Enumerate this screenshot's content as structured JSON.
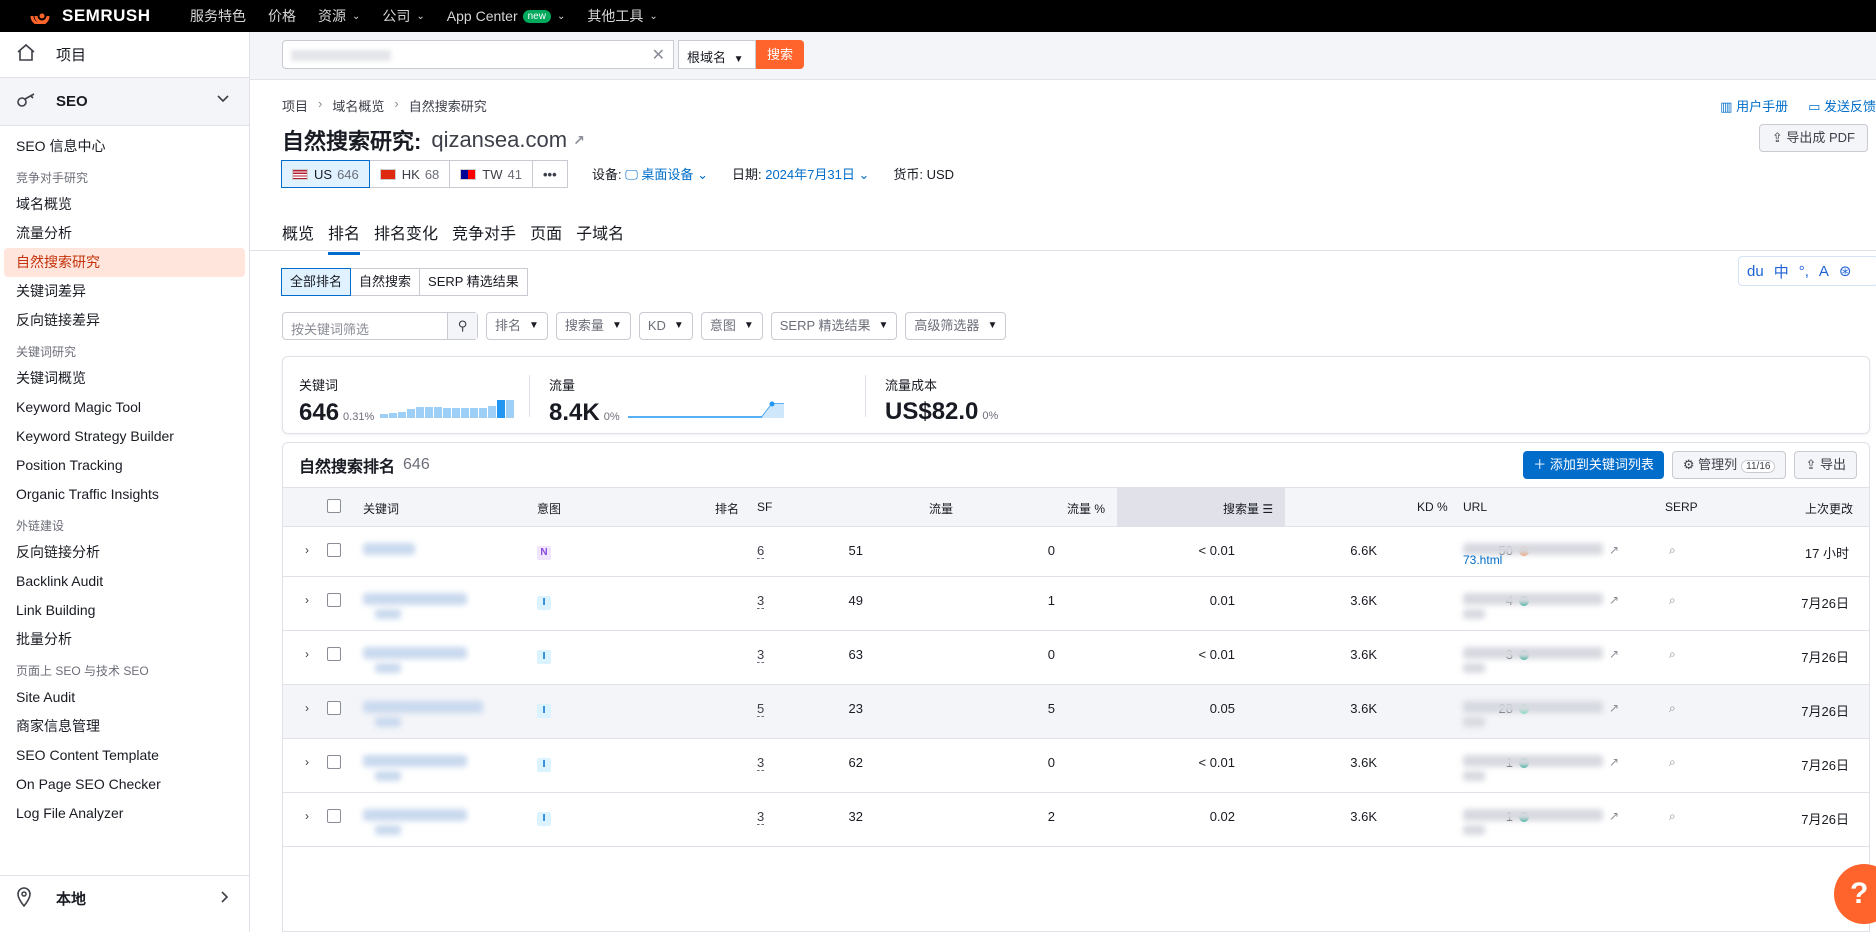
{
  "topbar": {
    "brand": "SEMRUSH",
    "nav": [
      {
        "label": "服务特色",
        "chev": false
      },
      {
        "label": "价格",
        "chev": false
      },
      {
        "label": "资源",
        "chev": true
      },
      {
        "label": "公司",
        "chev": true
      },
      {
        "label": "App Center",
        "chev": true,
        "badge": "new"
      },
      {
        "label": "其他工具",
        "chev": true
      }
    ]
  },
  "sidebar": {
    "project": "项目",
    "seo": "SEO",
    "items": [
      {
        "t": "item",
        "label": "SEO 信息中心"
      },
      {
        "t": "head",
        "label": "竞争对手研究"
      },
      {
        "t": "item",
        "label": "域名概览"
      },
      {
        "t": "item",
        "label": "流量分析"
      },
      {
        "t": "item",
        "label": "自然搜索研究",
        "active": true
      },
      {
        "t": "item",
        "label": "关键词差异"
      },
      {
        "t": "item",
        "label": "反向链接差异"
      },
      {
        "t": "head",
        "label": "关键词研究"
      },
      {
        "t": "item",
        "label": "关键词概览"
      },
      {
        "t": "item",
        "label": "Keyword Magic Tool"
      },
      {
        "t": "item",
        "label": "Keyword Strategy Builder"
      },
      {
        "t": "item",
        "label": "Position Tracking"
      },
      {
        "t": "item",
        "label": "Organic Traffic Insights"
      },
      {
        "t": "head",
        "label": "外链建设"
      },
      {
        "t": "item",
        "label": "反向链接分析"
      },
      {
        "t": "item",
        "label": "Backlink Audit"
      },
      {
        "t": "item",
        "label": "Link Building"
      },
      {
        "t": "item",
        "label": "批量分析"
      },
      {
        "t": "head",
        "label": "页面上 SEO 与技术 SEO"
      },
      {
        "t": "item",
        "label": "Site Audit"
      },
      {
        "t": "item",
        "label": "商家信息管理"
      },
      {
        "t": "item",
        "label": "SEO Content Template"
      },
      {
        "t": "item",
        "label": "On Page SEO Checker"
      },
      {
        "t": "item",
        "label": "Log File Analyzer"
      }
    ],
    "local": "本地"
  },
  "search": {
    "select": "根域名",
    "button": "搜索"
  },
  "breadcrumb": [
    "项目",
    "域名概览",
    "自然搜索研究"
  ],
  "toplinks": {
    "manual": "用户手册",
    "feedback": "发送反馈"
  },
  "title": {
    "label": "自然搜索研究:",
    "domain": "qizansea.com"
  },
  "export_pdf": "导出成 PDF",
  "countries": [
    {
      "code": "US",
      "num": "646",
      "selected": true
    },
    {
      "code": "HK",
      "num": "68"
    },
    {
      "code": "TW",
      "num": "41"
    }
  ],
  "meta": {
    "device_label": "设备:",
    "device": "桌面设备",
    "date_label": "日期:",
    "date": "2024年7月31日",
    "currency_label": "货币:",
    "currency": "USD"
  },
  "tabs": [
    "概览",
    "排名",
    "排名变化",
    "竞争对手",
    "页面",
    "子域名"
  ],
  "segments": [
    "全部排名",
    "自然搜索",
    "SERP 精选结果"
  ],
  "filters": {
    "placeholder": "按关键词筛选",
    "dropdowns": [
      "排名",
      "搜索量",
      "KD",
      "意图",
      "SERP 精选结果",
      "高级筛选器"
    ]
  },
  "stats": {
    "keywords": {
      "label": "关键词",
      "value": "646",
      "pct": "0.31%"
    },
    "traffic": {
      "label": "流量",
      "value": "8.4K",
      "pct": "0%"
    },
    "cost": {
      "label": "流量成本",
      "value": "US$82.0",
      "pct": "0%"
    }
  },
  "table": {
    "title": "自然搜索排名",
    "count": "646",
    "add_button": "添加到关键词列表",
    "manage": "管理列",
    "manage_count": "11/16",
    "export": "导出",
    "headers": {
      "keyword": "关键词",
      "intent": "意图",
      "pos": "排名",
      "sf": "SF",
      "traffic": "流量",
      "traffic_pct": "流量 %",
      "volume": "搜索量",
      "kd": "KD %",
      "url": "URL",
      "serp": "SERP",
      "updated": "上次更改"
    },
    "rows": [
      {
        "intent": "N",
        "pos": "51",
        "sf": "6",
        "traffic": "0",
        "tpct": "< 0.01",
        "vol": "6.6K",
        "kd": "50",
        "kdc": "#ff8c43",
        "url_tail": "73.html",
        "updated": "17 小时"
      },
      {
        "intent": "I",
        "pos": "49",
        "sf": "3",
        "traffic": "1",
        "tpct": "0.01",
        "vol": "3.6K",
        "kd": "4",
        "kdc": "#009f81",
        "url_tail": "",
        "updated": "7月26日"
      },
      {
        "intent": "I",
        "pos": "63",
        "sf": "3",
        "traffic": "0",
        "tpct": "< 0.01",
        "vol": "3.6K",
        "kd": "3",
        "kdc": "#009f81",
        "url_tail": "",
        "updated": "7月26日"
      },
      {
        "intent": "I",
        "pos": "23",
        "sf": "5",
        "traffic": "5",
        "tpct": "0.05",
        "vol": "3.6K",
        "kd": "28",
        "kdc": "#59ddaa",
        "url_tail": "",
        "updated": "7月26日"
      },
      {
        "intent": "I",
        "pos": "62",
        "sf": "3",
        "traffic": "0",
        "tpct": "< 0.01",
        "vol": "3.6K",
        "kd": "1",
        "kdc": "#009f81",
        "url_tail": "",
        "updated": "7月26日"
      },
      {
        "intent": "I",
        "pos": "32",
        "sf": "3",
        "traffic": "2",
        "tpct": "0.02",
        "vol": "3.6K",
        "kd": "1",
        "kdc": "#009f81",
        "url_tail": "",
        "updated": "7月26日"
      }
    ]
  },
  "help": "?",
  "toolbar_ext": [
    "du",
    "中",
    "°,",
    "A",
    "⊛"
  ]
}
